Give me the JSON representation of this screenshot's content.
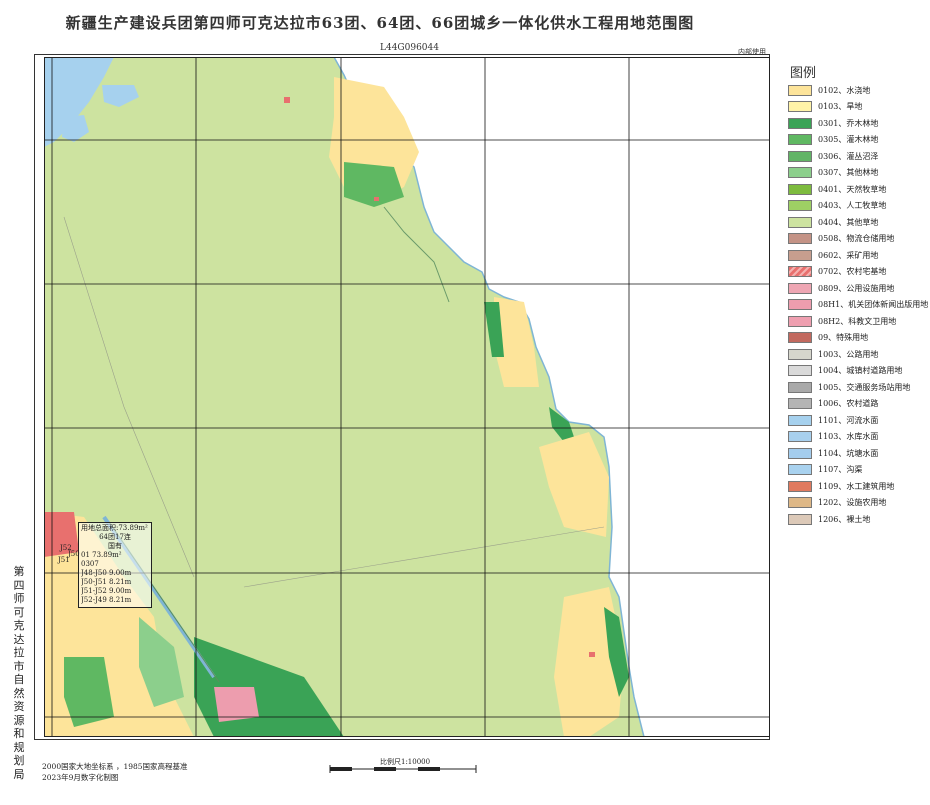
{
  "title": "新疆生产建设兵团第四师可克达拉市63团、64团、66团城乡一体化供水工程用地范围图",
  "sheet_number": "L44G096044",
  "secret_label": "内部使用",
  "side_text": "第四师可克达拉市自然资源和规划局",
  "footer": {
    "line1": "2000国家大地坐标系 ，1985国家高程基准",
    "line2": "2023年9月数字化制图"
  },
  "scale_label": "比例尺1:10000",
  "legend_title": "图例",
  "legend": [
    {
      "label": "0102、水浇地",
      "color": "#fde49a"
    },
    {
      "label": "0103、旱地",
      "color": "#fff3a8"
    },
    {
      "label": "0301、乔木林地",
      "color": "#3aa356"
    },
    {
      "label": "0305、灌木林地",
      "color": "#5fb862"
    },
    {
      "label": "0306、灌丛沼泽",
      "color": "#62b466"
    },
    {
      "label": "0307、其他林地",
      "color": "#8ccf8c"
    },
    {
      "label": "0401、天然牧草地",
      "color": "#7dbb3e"
    },
    {
      "label": "0403、人工牧草地",
      "color": "#9ed064"
    },
    {
      "label": "0404、其他草地",
      "color": "#cde3a0"
    },
    {
      "label": "0508、物流仓储用地",
      "color": "#c49386"
    },
    {
      "label": "0602、采矿用地",
      "color": "#c79e8e"
    },
    {
      "label": "0702、农村宅基地",
      "color": "#e8706e"
    },
    {
      "label": "0809、公用设施用地",
      "color": "#eea6b3"
    },
    {
      "label": "08H1、机关团体新闻出版用地",
      "color": "#ed9dae"
    },
    {
      "label": "08H2、科教文卫用地",
      "color": "#ef9fb0"
    },
    {
      "label": "09、特殊用地",
      "color": "#c2695f"
    },
    {
      "label": "1003、公路用地",
      "color": "#d6d6cc"
    },
    {
      "label": "1004、城镇村道路用地",
      "color": "#dadada"
    },
    {
      "label": "1005、交通服务场站用地",
      "color": "#a9a9a9"
    },
    {
      "label": "1006、农村道路",
      "color": "#b4b4b4"
    },
    {
      "label": "1101、河流水面",
      "color": "#a6d1ee"
    },
    {
      "label": "1103、水库水面",
      "color": "#a8d0ee"
    },
    {
      "label": "1104、坑塘水面",
      "color": "#a4cdee"
    },
    {
      "label": "1107、沟渠",
      "color": "#a9d2ef"
    },
    {
      "label": "1109、水工建筑用地",
      "color": "#e07a5f"
    },
    {
      "label": "1202、设施农用地",
      "color": "#deb887"
    },
    {
      "label": "1206、裸土地",
      "color": "#dcc9b8"
    }
  ],
  "infobox": {
    "lines": [
      "用地总面积:73.89m²",
      "64团17连",
      "国有",
      "01   73.89m²",
      "0307",
      "J48-J50  9.00m",
      "J50-J51  8.21m",
      "J51-J52  9.00m",
      "J52-J49  8.21m"
    ]
  },
  "point_labels": [
    "J52",
    "J50",
    "J51"
  ]
}
